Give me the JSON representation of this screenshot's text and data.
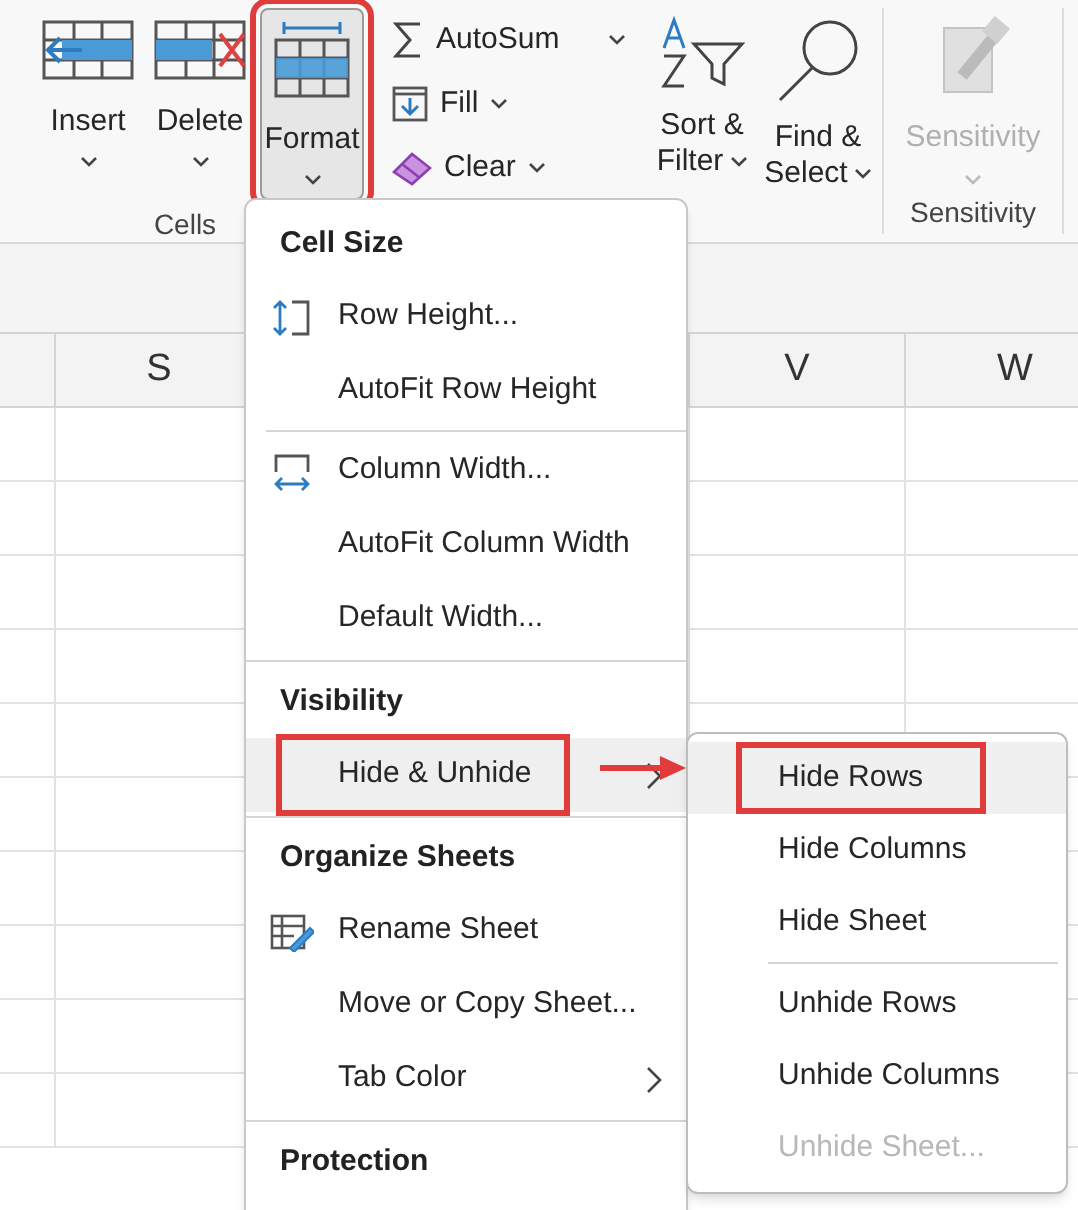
{
  "ribbon": {
    "cells_group": {
      "label": "Cells",
      "buttons": [
        {
          "kind": "insert",
          "label": "Insert",
          "selected": false,
          "annotated": false
        },
        {
          "kind": "delete",
          "label": "Delete",
          "selected": false,
          "annotated": false
        },
        {
          "kind": "format",
          "label": "Format",
          "selected": true,
          "annotated": true
        }
      ]
    },
    "editing_group": {
      "small_buttons": [
        {
          "kind": "autosum",
          "label": "AutoSum"
        },
        {
          "kind": "fill",
          "label": "Fill"
        },
        {
          "kind": "clear",
          "label": "Clear"
        }
      ],
      "large_buttons": [
        {
          "kind": "sort",
          "label": "Sort & Filter"
        },
        {
          "kind": "find",
          "label": "Find & Select"
        }
      ]
    },
    "sensitivity_group": {
      "label": "Sensitivity",
      "button": {
        "label": "Sensitivity",
        "disabled": true
      }
    }
  },
  "sheet": {
    "columns": [
      {
        "label": "S"
      },
      {
        "label": "V"
      },
      {
        "label": "W"
      }
    ]
  },
  "format_menu": {
    "sections": [
      {
        "heading": "Cell Size",
        "items": [
          {
            "kind": "row-height",
            "label": "Row Height..."
          },
          {
            "kind": "plain",
            "label": "AutoFit Row Height"
          },
          {
            "kind": "separator"
          },
          {
            "kind": "column-width",
            "label": "Column Width..."
          },
          {
            "kind": "plain",
            "label": "AutoFit Column Width"
          },
          {
            "kind": "plain",
            "label": "Default Width..."
          }
        ]
      },
      {
        "heading": "Visibility",
        "items": [
          {
            "kind": "plain",
            "label": "Hide & Unhide",
            "submenu": true,
            "selected": true,
            "annotated": true
          }
        ]
      },
      {
        "heading": "Organize Sheets",
        "items": [
          {
            "kind": "rename",
            "label": "Rename Sheet"
          },
          {
            "kind": "plain",
            "label": "Move or Copy Sheet..."
          },
          {
            "kind": "plain",
            "label": "Tab Color",
            "submenu": true,
            "selected": false
          }
        ]
      },
      {
        "heading": "Protection"
      }
    ]
  },
  "submenu": {
    "items": [
      {
        "kind": "plain",
        "label": "Hide Rows",
        "selected": true,
        "annotated": true,
        "disabled": false
      },
      {
        "kind": "plain",
        "label": "Hide Columns",
        "selected": false,
        "annotated": false,
        "disabled": false
      },
      {
        "kind": "plain",
        "label": "Hide Sheet",
        "selected": false,
        "annotated": false,
        "disabled": false
      },
      {
        "kind": "separator"
      },
      {
        "kind": "plain",
        "label": "Unhide Rows",
        "selected": false,
        "annotated": false,
        "disabled": false
      },
      {
        "kind": "plain",
        "label": "Unhide Columns",
        "selected": false,
        "annotated": false,
        "disabled": false
      },
      {
        "kind": "plain",
        "label": "Unhide Sheet...",
        "selected": false,
        "annotated": false,
        "disabled": true
      }
    ]
  }
}
